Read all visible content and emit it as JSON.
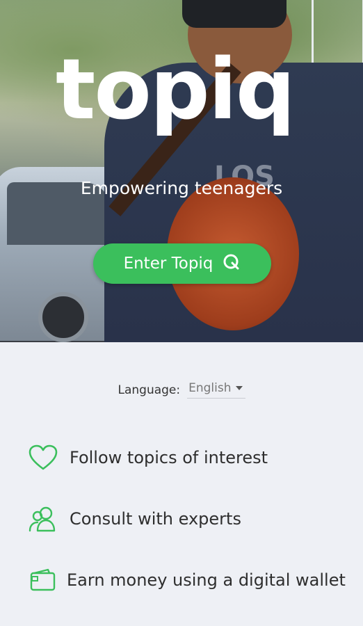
{
  "hero": {
    "logo_text": "topiq",
    "tagline": "Empowering teenagers",
    "enter_label": "Enter Topiq",
    "shirt_text": "LOS\nAN\n52"
  },
  "language": {
    "label": "Language:",
    "selected": "English"
  },
  "features": [
    {
      "icon": "heart-icon",
      "label": "Follow topics of interest"
    },
    {
      "icon": "users-icon",
      "label": "Consult with experts"
    },
    {
      "icon": "wallet-icon",
      "label": "Earn money using a digital wallet"
    }
  ],
  "colors": {
    "accent": "#3bbf5c",
    "background": "#eef0f5"
  }
}
